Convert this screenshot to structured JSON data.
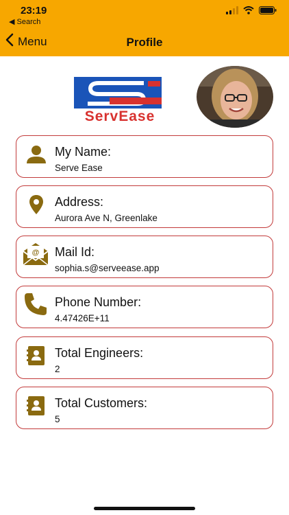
{
  "status_bar": {
    "time": "23:19",
    "back_app": "◀ Search"
  },
  "nav": {
    "back_label": "Menu",
    "title": "Profile"
  },
  "logo": {
    "brand_text": "ServEase",
    "colors": {
      "blue": "#1a54b8",
      "red": "#d8322f"
    }
  },
  "colors": {
    "header": "#f7a700",
    "icon": "#8a6a10",
    "card_border": "#c23a3a"
  },
  "fields": [
    {
      "icon": "person-icon",
      "label": "My Name:",
      "value": "Serve Ease"
    },
    {
      "icon": "location-pin-icon",
      "label": "Address:",
      "value": "Aurora Ave N, Greenlake"
    },
    {
      "icon": "mail-icon",
      "label": "Mail Id:",
      "value": "sophia.s@serveease.app"
    },
    {
      "icon": "phone-icon",
      "label": "Phone Number:",
      "value": "4.47426E+11"
    },
    {
      "icon": "contact-book-icon",
      "label": "Total Engineers:",
      "value": "2"
    },
    {
      "icon": "contact-book-icon",
      "label": "Total Customers:",
      "value": "5"
    }
  ]
}
